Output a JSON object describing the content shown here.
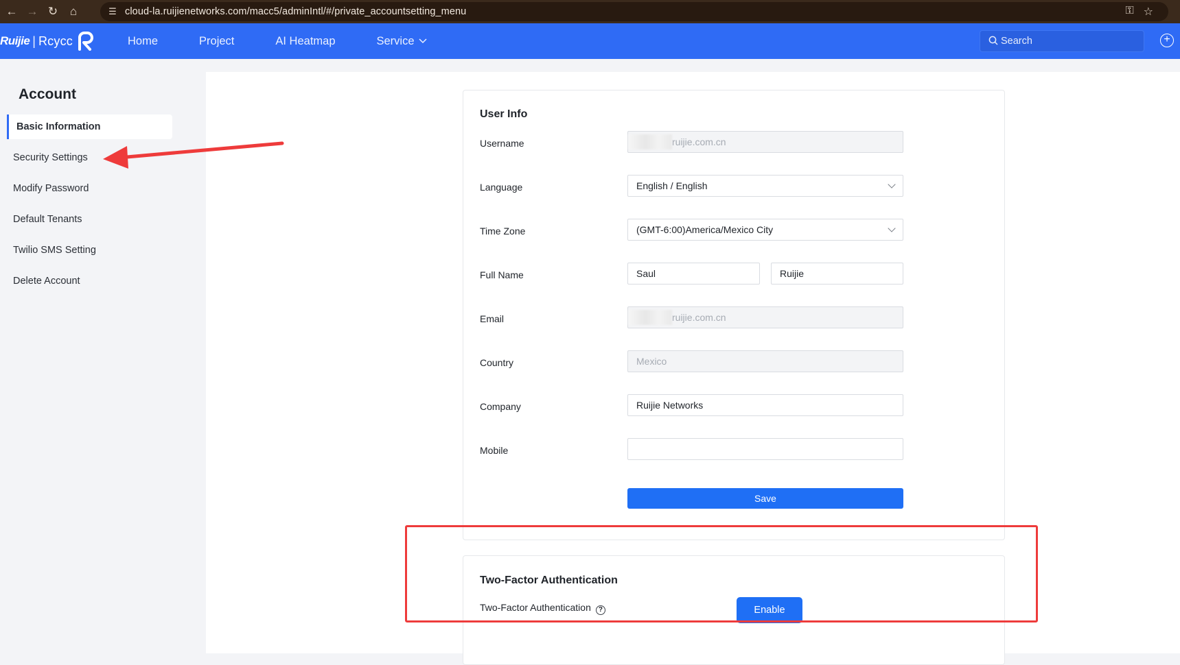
{
  "browser": {
    "url": "cloud-la.ruijienetworks.com/macc5/adminIntl/#/private_accountsetting_menu"
  },
  "header": {
    "brand": "Ruijie",
    "sub_brand": "Rcycc",
    "menu": [
      {
        "label": "Home"
      },
      {
        "label": "Project"
      },
      {
        "label": "AI Heatmap"
      },
      {
        "label": "Service"
      }
    ],
    "search_placeholder": "Search"
  },
  "sidebar": {
    "title": "Account",
    "items": [
      {
        "label": "Basic Information"
      },
      {
        "label": "Security Settings"
      },
      {
        "label": "Modify Password"
      },
      {
        "label": "Default Tenants"
      },
      {
        "label": "Twilio SMS Setting"
      },
      {
        "label": "Delete Account"
      }
    ]
  },
  "user_info": {
    "title": "User Info",
    "username_label": "Username",
    "username_value": "ruijie.com.cn",
    "language_label": "Language",
    "language_value": "English / English",
    "timezone_label": "Time Zone",
    "timezone_value": "(GMT-6:00)America/Mexico City",
    "fullname_label": "Full Name",
    "first_name": "Saul",
    "last_name": "Ruijie",
    "email_label": "Email",
    "email_value": "ruijie.com.cn",
    "country_label": "Country",
    "country_value": "Mexico",
    "company_label": "Company",
    "company_value": "Ruijie Networks",
    "mobile_label": "Mobile",
    "mobile_value": "",
    "save_label": "Save"
  },
  "two_factor": {
    "title": "Two-Factor Authentication",
    "label": "Two-Factor Authentication",
    "button_label": "Enable"
  },
  "colors": {
    "brand_blue": "#2f6bf5",
    "button_blue": "#1f6ff5",
    "annotation_red": "#ee3b3b"
  }
}
